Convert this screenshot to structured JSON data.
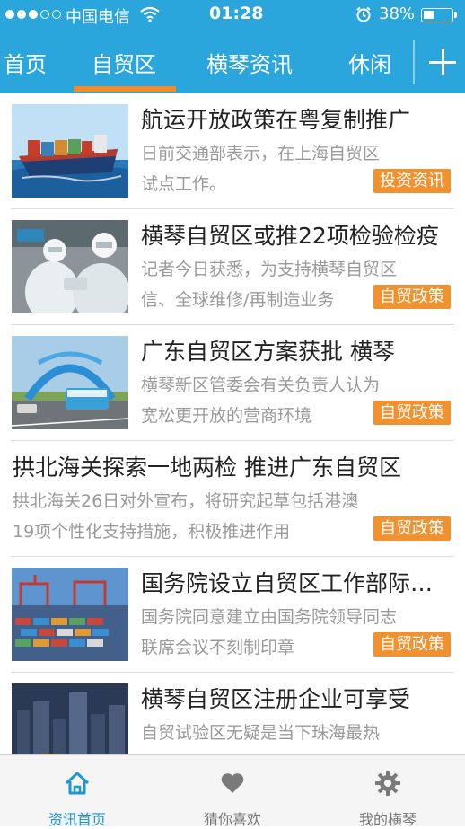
{
  "status": {
    "carrier": "中国电信",
    "time": "01:28",
    "battery": "38%"
  },
  "tabs": [
    {
      "label": "首页"
    },
    {
      "label": "自贸区",
      "active": true
    },
    {
      "label": "横琴资讯"
    },
    {
      "label": "休闲"
    }
  ],
  "articles": [
    {
      "title": "航运开放政策在粤复制推广",
      "desc1": "日前交通部表示，在上海自贸区",
      "desc2": "试点工作。",
      "tag": "投资资讯",
      "image": "cargo-ship"
    },
    {
      "title": "横琴自贸区或推22项检验检疫",
      "desc1": "记者今日获悉，为支持横琴自贸区",
      "desc2": "信、全球维修/再制造业务",
      "tag": "自贸政策",
      "image": "inspection-workers"
    },
    {
      "title": "广东自贸区方案获批 横琴",
      "desc1": "横琴新区管委会有关负责人认为",
      "desc2": "宽松更开放的营商环境",
      "tag": "自贸政策",
      "image": "arch-bus"
    },
    {
      "title": "拱北海关探索一地两检 推进广东自贸区",
      "desc1": "拱北海关26日对外宣布，将研究起草包括港澳",
      "desc2": "19项个性化支持措施，积极推进作用",
      "tag": "自贸政策",
      "image": ""
    },
    {
      "title": "国务院设立自贸区工作部际联席会议",
      "desc1": "国务院同意建立由国务院领导同志",
      "desc2": "联席会议不刻制印章",
      "tag": "自贸政策",
      "image": "container-port"
    },
    {
      "title": "横琴自贸区注册企业可享受",
      "desc1": "自贸试验区无疑是当下珠海最热",
      "desc2": "",
      "tag": "",
      "image": "city-night"
    }
  ],
  "bottom_nav": [
    {
      "label": "资讯首页",
      "icon": "home-icon",
      "active": true
    },
    {
      "label": "猜你喜欢",
      "icon": "heart-icon"
    },
    {
      "label": "我的横琴",
      "icon": "gear-icon"
    }
  ],
  "colors": {
    "header": "#2aa6dc",
    "tag": "#f0922f",
    "tab_underline": "#f08c2c",
    "active_nav": "#1f97d4"
  }
}
